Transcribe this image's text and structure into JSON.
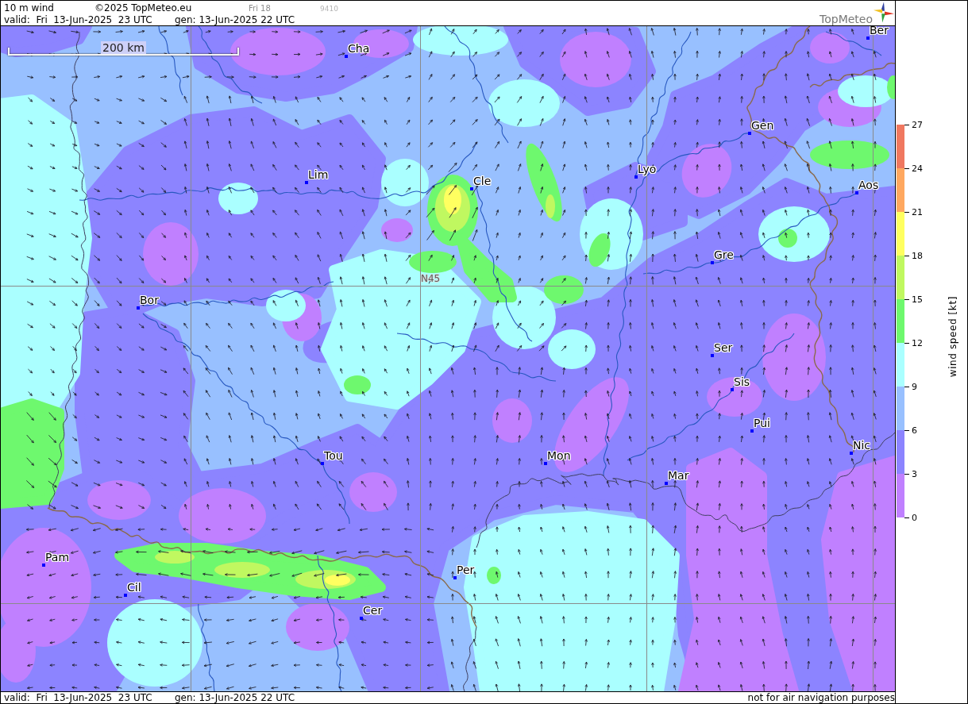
{
  "header": {
    "title": "10 m wind",
    "copyright": "©2025 TopMeteo.eu",
    "day": "Fri 18",
    "code": "9410",
    "valid": "valid:  Fri  13-Jun-2025  23 UTC",
    "generated": "gen: 13-Jun-2025 22 UTC",
    "logo": "TopMeteo"
  },
  "map": {
    "scale": "200 km",
    "latitude": "N45",
    "cities": [
      {
        "name": "Ber"
      },
      {
        "name": "Cha"
      },
      {
        "name": "Gen"
      },
      {
        "name": "Lim"
      },
      {
        "name": "Cle"
      },
      {
        "name": "Lyo"
      },
      {
        "name": "Aos"
      },
      {
        "name": "Gre"
      },
      {
        "name": "Bor"
      },
      {
        "name": "Ser"
      },
      {
        "name": "Sis"
      },
      {
        "name": "Pui"
      },
      {
        "name": "Nic"
      },
      {
        "name": "Tou"
      },
      {
        "name": "Mon"
      },
      {
        "name": "Mar"
      },
      {
        "name": "Pam"
      },
      {
        "name": "Per"
      },
      {
        "name": "Cil"
      },
      {
        "name": "Cer"
      }
    ]
  },
  "legend": {
    "title": "wind speed [kt]",
    "ticks": [
      "27",
      "24",
      "21",
      "18",
      "15",
      "12",
      "9",
      "6",
      "3",
      "0"
    ],
    "bands": [
      {
        "color": "#f07860"
      },
      {
        "color": "#ffa860"
      },
      {
        "color": "#ffff60"
      },
      {
        "color": "#c0f860"
      },
      {
        "color": "#6ef86e"
      },
      {
        "color": "#aaffff"
      },
      {
        "color": "#98c0ff"
      },
      {
        "color": "#8c84ff"
      },
      {
        "color": "#c080ff"
      }
    ]
  },
  "footer": {
    "valid": "valid:  Fri  13-Jun-2025  23 UTC",
    "generated": "gen: 13-Jun-2025 22 UTC",
    "notice": "not for air navigation purposes"
  }
}
